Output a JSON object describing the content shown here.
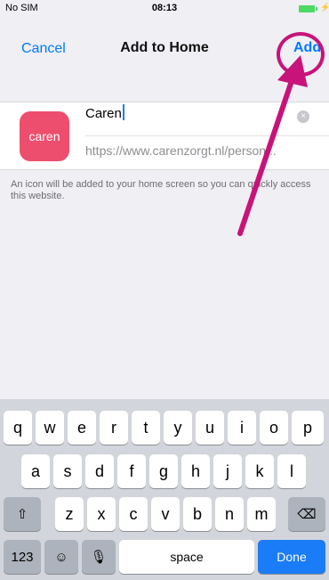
{
  "status_bar": {
    "carrier": "No SIM",
    "time": "08:13",
    "charge": "⚡"
  },
  "nav": {
    "cancel": "Cancel",
    "title": "Add to Home",
    "add": "Add"
  },
  "card": {
    "icon_text": "caren",
    "name_value": "Caren",
    "clear_icon": "×",
    "url": "https://www.carenzorgt.nl/person..."
  },
  "hint": "An icon will be added to your home screen so you can quickly access this website.",
  "keyboard": {
    "row1": [
      "q",
      "w",
      "e",
      "r",
      "t",
      "y",
      "u",
      "i",
      "o",
      "p"
    ],
    "row2": [
      "a",
      "s",
      "d",
      "f",
      "g",
      "h",
      "j",
      "k",
      "l"
    ],
    "row3": [
      "z",
      "x",
      "c",
      "v",
      "b",
      "n",
      "m"
    ],
    "shift": "⇧",
    "backspace": "⌫",
    "numbers": "123",
    "emoji": "☺",
    "mic": "🎙",
    "space": "space",
    "done": "Done"
  },
  "colors": {
    "accent": "#007aff",
    "annotation": "#c8137a",
    "icon_bg": "#ee4e6e",
    "done_key": "#1a7cf6"
  }
}
